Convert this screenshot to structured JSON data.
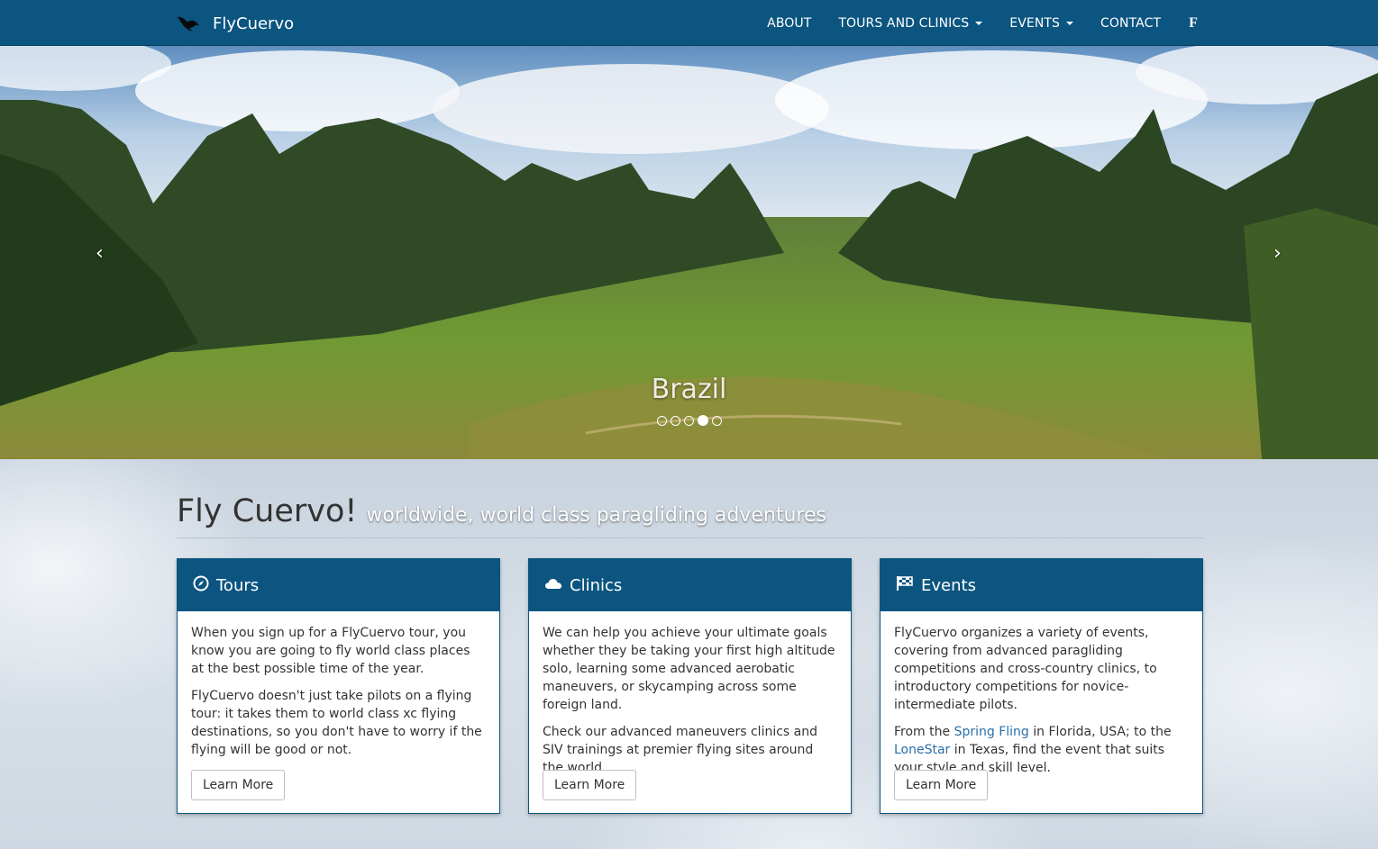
{
  "brand": {
    "name": "FlyCuervo",
    "logo_icon": "crow-icon"
  },
  "nav": {
    "items": [
      {
        "label": "ABOUT",
        "dropdown": false
      },
      {
        "label": "TOURS AND CLINICS",
        "dropdown": true
      },
      {
        "label": "EVENTS",
        "dropdown": true
      },
      {
        "label": "CONTACT",
        "dropdown": false
      }
    ],
    "social_icon": "facebook-icon",
    "social_glyph": "f"
  },
  "carousel": {
    "caption": "Brazil",
    "slide_count": 5,
    "active_index": 3,
    "prev_glyph": "‹",
    "next_glyph": "›"
  },
  "intro": {
    "title": "Fly Cuervo!",
    "subtitle": "worldwide, world class paragliding adventures"
  },
  "panels": [
    {
      "title": "Tours",
      "icon": "compass-icon",
      "p1": "When you sign up for a FlyCuervo tour, you know you are going to fly world class places at the best possible time of the year.",
      "p2": "FlyCuervo doesn't just take pilots on a flying tour: it takes them to world class xc flying destinations, so you don't have to worry if the flying will be good or not.",
      "button": "Learn More"
    },
    {
      "title": "Clinics",
      "icon": "cloud-icon",
      "p1": "We can help you achieve your ultimate goals whether they be taking your first high altitude solo, learning some advanced aerobatic maneuvers, or skycamping across some foreign land.",
      "p2": "Check our advanced maneuvers clinics and SIV trainings at premier flying sites around the world.",
      "button": "Learn More"
    },
    {
      "title": "Events",
      "icon": "flag-icon",
      "p1": "FlyCuervo organizes a variety of events, covering from advanced paragliding competitions and cross-country clinics, to introductory competitions for novice-intermediate pilots.",
      "p2_prefix": "From the ",
      "p2_link1": "Spring Fling",
      "p2_mid": " in Florida, USA; to the ",
      "p2_link2": "LoneStar",
      "p2_suffix": " in Texas, find the event that suits your style and skill level.",
      "button": "Learn More"
    }
  ],
  "colors": {
    "primary": "#0b5580",
    "link": "#2a6fa8",
    "background": "#dfe5ec"
  }
}
